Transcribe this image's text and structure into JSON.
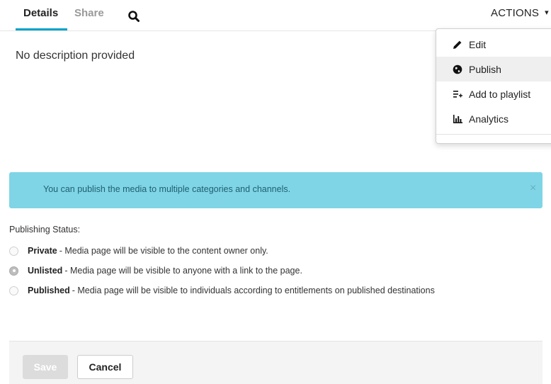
{
  "tabs": {
    "details": "Details",
    "share": "Share",
    "search_icon": "search-icon"
  },
  "actions": {
    "label": "ACTIONS",
    "caret": "▾"
  },
  "description": "No description provided",
  "dropdown": {
    "items": [
      {
        "label": "Edit",
        "icon": "pencil-icon"
      },
      {
        "label": "Publish",
        "icon": "globe-icon",
        "active": true
      },
      {
        "label": "Add to playlist",
        "icon": "playlist-add-icon"
      },
      {
        "label": "Analytics",
        "icon": "bar-chart-icon"
      }
    ]
  },
  "alert": {
    "text": "You can publish the media to multiple categories and channels.",
    "close": "×"
  },
  "publishing": {
    "label": "Publishing Status:",
    "options": [
      {
        "name": "Private",
        "desc": " - Media page will be visible to the content owner only.",
        "checked": false
      },
      {
        "name": "Unlisted",
        "desc": " - Media page will be visible to anyone with a link to the page.",
        "checked": true
      },
      {
        "name": "Published",
        "desc": " - Media page will be visible to individuals according to entitlements on published destinations",
        "checked": false
      }
    ]
  },
  "footer": {
    "save": "Save",
    "cancel": "Cancel"
  },
  "colors": {
    "accent": "#00a2c7",
    "alert_bg": "#7fd5e6",
    "alert_text": "#1f5f70"
  }
}
